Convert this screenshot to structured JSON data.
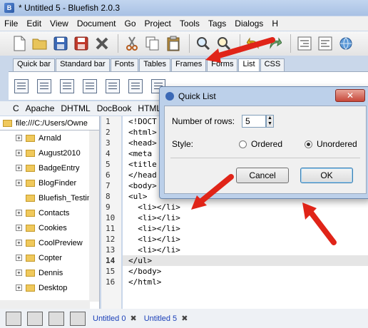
{
  "window": {
    "title": "* Untitled 5 - Bluefish 2.0.3"
  },
  "menubar": [
    "File",
    "Edit",
    "View",
    "Document",
    "Go",
    "Project",
    "Tools",
    "Tags",
    "Dialogs",
    "H"
  ],
  "toolbar": {
    "icons": [
      "new-file-icon",
      "open-folder-icon",
      "save-icon",
      "save-as-icon",
      "close-icon",
      "cut-icon",
      "copy-icon",
      "paste-icon",
      "search-icon",
      "replace-icon",
      "undo-icon",
      "redo-icon",
      "indent-icon",
      "unindent-icon",
      "preview-icon"
    ]
  },
  "tabs": [
    "Quick bar",
    "Standard bar",
    "Fonts",
    "Tables",
    "Frames",
    "Forms",
    "List",
    "CSS"
  ],
  "active_tab": "List",
  "languages": [
    "C",
    "Apache",
    "DHTML",
    "DocBook",
    "HTML"
  ],
  "filebrowser": {
    "path": "file:///C:/Users/Owne",
    "items": [
      "Arnald",
      "August2010",
      "BadgeEntry",
      "BlogFinder",
      "Bluefish_Testin",
      "Contacts",
      "Cookies",
      "CoolPreview",
      "Copter",
      "Dennis",
      "Desktop"
    ]
  },
  "editor": {
    "line_numbers": [
      "1",
      "2",
      "3",
      "4",
      "5",
      "6",
      "7",
      "8",
      "9",
      "10",
      "11",
      "12",
      "13",
      "14",
      "15",
      "16"
    ],
    "lines": [
      "<!DOCT",
      "<html>",
      "<head>",
      "<meta ",
      "<title",
      "</head",
      "<body>",
      "<ul>",
      "  <li></li>",
      "  <li></li>",
      "  <li></li>",
      "  <li></li>",
      "  <li></li>",
      "</ul>",
      "</body>",
      "</html>"
    ],
    "highlight_line": 14
  },
  "dialog": {
    "title": "Quick List",
    "rows_label": "Number of rows:",
    "rows_value": "5",
    "style_label": "Style:",
    "opt_ordered": "Ordered",
    "opt_unordered": "Unordered",
    "cancel": "Cancel",
    "ok": "OK"
  },
  "document_tabs": [
    "Untitled 0",
    "Untitled 5"
  ],
  "active_document": "Untitled 5",
  "colors": {
    "arrow": "#e02418",
    "accent": "#1a3fb8"
  }
}
